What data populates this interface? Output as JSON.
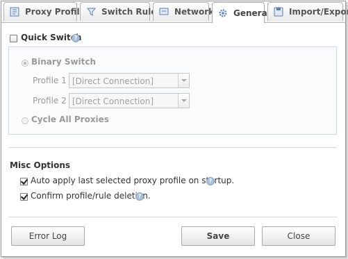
{
  "tabs": [
    {
      "label": "Proxy Profiles",
      "icon": "profiles-icon"
    },
    {
      "label": "Switch Rules",
      "icon": "filter-icon"
    },
    {
      "label": "Network",
      "icon": "network-icon"
    },
    {
      "label": "General",
      "icon": "gear-icon",
      "active": true
    },
    {
      "label": "Import/Export",
      "icon": "disk-icon"
    }
  ],
  "quick_switch": {
    "label": "Quick Switch",
    "checked": false,
    "help": "?",
    "binary_switch_label": "Binary Switch",
    "profile1_label": "Profile 1",
    "profile1_value": "[Direct Connection]",
    "profile2_label": "Profile 2",
    "profile2_value": "[Direct Connection]",
    "cycle_label": "Cycle All Proxies"
  },
  "misc": {
    "title": "Misc Options",
    "auto_apply_label": "Auto apply last selected proxy profile on startup.",
    "auto_apply_checked": true,
    "confirm_label": "Confirm profile/rule deletion.",
    "confirm_checked": true,
    "help": "?"
  },
  "buttons": {
    "error_log": "Error Log",
    "save": "Save",
    "close": "Close"
  },
  "colors": {
    "accent_help": "#a9bfda",
    "border": "#9a9a9a"
  }
}
